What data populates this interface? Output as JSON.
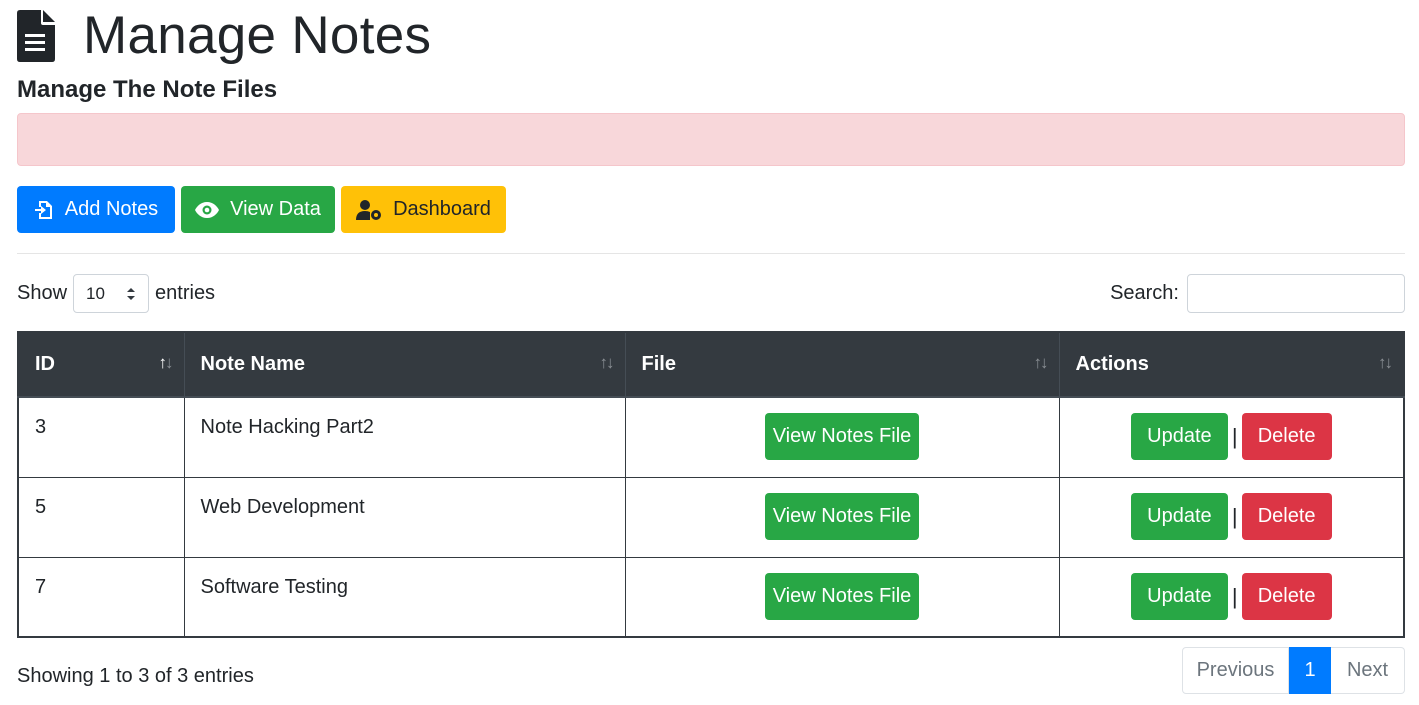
{
  "header": {
    "title": "Manage Notes",
    "subtitle": "Manage The Note Files",
    "icon": "file-document-icon"
  },
  "alert": {
    "text": "",
    "color": "#f8d7da"
  },
  "actions": {
    "add_notes": "Add Notes",
    "view_data": "View Data",
    "dashboard": "Dashboard"
  },
  "length_control": {
    "show_label": "Show",
    "selected": "10",
    "entries_label": "entries"
  },
  "search": {
    "label": "Search:",
    "value": ""
  },
  "table": {
    "columns": [
      "ID",
      "Note Name",
      "File",
      "Actions"
    ],
    "rows": [
      {
        "id": "3",
        "note_name": "Note Hacking Part2",
        "file_button": "View Notes File",
        "update": "Update",
        "separator": "|",
        "delete": "Delete"
      },
      {
        "id": "5",
        "note_name": "Web Development",
        "file_button": "View Notes File",
        "update": "Update",
        "separator": "|",
        "delete": "Delete"
      },
      {
        "id": "7",
        "note_name": "Software Testing",
        "file_button": "View Notes File",
        "update": "Update",
        "separator": "|",
        "delete": "Delete"
      }
    ]
  },
  "footer": {
    "info": "Showing 1 to 3 of 3 entries",
    "pagination": {
      "previous": "Previous",
      "current": "1",
      "next": "Next"
    }
  },
  "colors": {
    "primary": "#007bff",
    "success": "#28a745",
    "warning": "#ffc107",
    "danger": "#dc3545",
    "table_header": "#343a40"
  }
}
